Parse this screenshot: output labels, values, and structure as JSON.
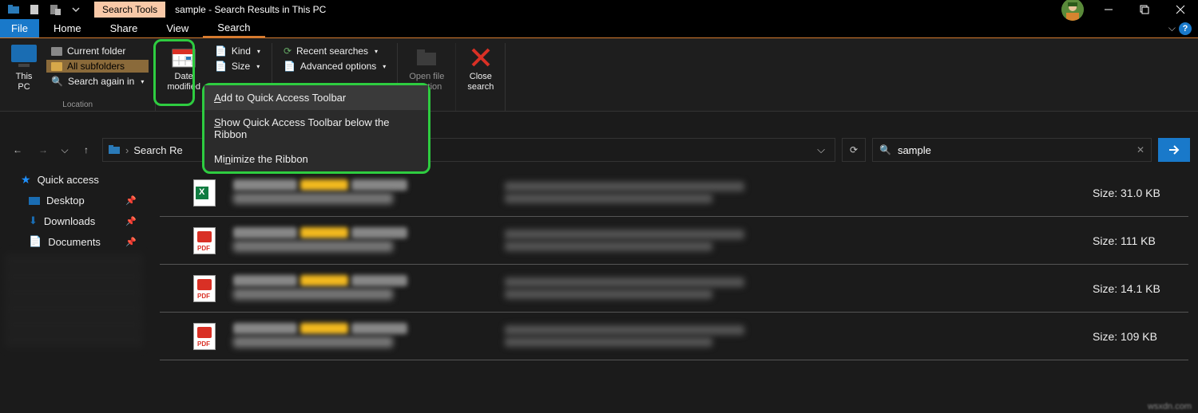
{
  "window": {
    "search_tools_label": "Search Tools",
    "title": "sample - Search Results in This PC"
  },
  "menu": {
    "file": "File",
    "home": "Home",
    "share": "Share",
    "view": "View",
    "search": "Search"
  },
  "ribbon": {
    "this_pc": "This\nPC",
    "current_folder": "Current folder",
    "all_subfolders": "All subfolders",
    "search_again_in": "Search again in",
    "location_group": "Location",
    "date_modified": "Date\nmodified",
    "kind": "Kind",
    "size": "Size",
    "recent_searches": "Recent searches",
    "advanced_options": "Advanced options",
    "open_file_location": "Open file\nlocation",
    "close_search": "Close\nsearch"
  },
  "context_menu": {
    "item1": "Add to Quick Access Toolbar",
    "item2": "Show Quick Access Toolbar below the Ribbon",
    "item3": "Minimize the Ribbon"
  },
  "breadcrumb": {
    "root_visible": "Search Re"
  },
  "search": {
    "value": "sample"
  },
  "sidebar": {
    "quick_access": "Quick access",
    "desktop": "Desktop",
    "downloads": "Downloads",
    "documents": "Documents"
  },
  "results": [
    {
      "icon": "excel",
      "size_label": "Size: 31.0 KB"
    },
    {
      "icon": "pdf",
      "size_label": "Size: 111 KB"
    },
    {
      "icon": "pdf",
      "size_label": "Size: 14.1 KB"
    },
    {
      "icon": "pdf",
      "size_label": "Size: 109 KB"
    }
  ],
  "watermark": "wsxdn.com"
}
